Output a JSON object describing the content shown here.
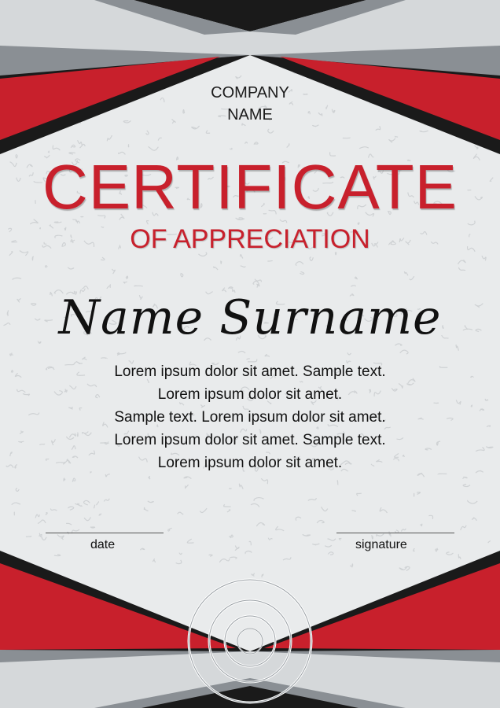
{
  "company": {
    "line1": "COMPANY",
    "line2": "NAME"
  },
  "certificate": {
    "title": "CERTIFICATE",
    "subtitle": "OF APPRECIATION",
    "recipient": "Name Surname",
    "body_lines": [
      "Lorem ipsum dolor sit amet. Sample text.",
      "Lorem ipsum dolor sit amet.",
      "Sample text. Lorem ipsum dolor sit amet.",
      "Lorem ipsum dolor sit amet. Sample text.",
      "Lorem ipsum dolor sit amet."
    ]
  },
  "footer": {
    "date_label": "date",
    "signature_label": "signature"
  },
  "colors": {
    "accent_red": "#c8202c",
    "band_black": "#1a1a1a",
    "band_gray": "#8a8f94",
    "light_gray": "#d5d8da",
    "paper": "#e9ebec"
  },
  "icons": {
    "seal": "concentric-circles-seal-icon"
  }
}
